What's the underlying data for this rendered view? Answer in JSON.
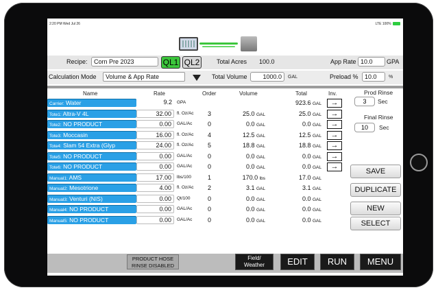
{
  "status": {
    "time": "2:20 PM  Wed Jul 26",
    "signal": "LTE",
    "battery": "100%"
  },
  "recipe": {
    "label": "Recipe:",
    "value": "Corn Pre 2023"
  },
  "quick_links": [
    "QL1",
    "QL2"
  ],
  "total_acres": {
    "label": "Total Acres",
    "value": "100.0"
  },
  "app_rate": {
    "label": "App Rate",
    "value": "10.0",
    "unit": "GPA"
  },
  "calc_mode": {
    "label": "Calculation Mode",
    "value": "Volume & App Rate"
  },
  "total_volume": {
    "label": "Total Volume",
    "value": "1000.0",
    "unit": "GAL"
  },
  "preload": {
    "label": "Preload %",
    "value": "10.0",
    "unit": "%"
  },
  "table": {
    "headers": [
      "Name",
      "Rate",
      "Order",
      "Volume",
      "Total",
      "Inv."
    ],
    "rows": [
      {
        "prefix": "Carrier:",
        "name": "Water",
        "rate": "9.2",
        "rate_unit": "GPA",
        "order": "",
        "volume": "",
        "volume_unit": "",
        "total": "923.6",
        "total_unit": "GAL",
        "inv": true,
        "rate_boxed": false
      },
      {
        "prefix": "Tote1:",
        "name": "Altra-V 4L",
        "rate": "32.00",
        "rate_unit": "fl. Oz/Ac",
        "order": "3",
        "volume": "25.0",
        "volume_unit": "GAL",
        "total": "25.0",
        "total_unit": "GAL",
        "inv": true,
        "rate_boxed": true
      },
      {
        "prefix": "Tote2:",
        "name": "NO PRODUCT",
        "rate": "0.00",
        "rate_unit": "GAL/Ac",
        "order": "0",
        "volume": "0.0",
        "volume_unit": "GAL",
        "total": "0.0",
        "total_unit": "GAL",
        "inv": true,
        "rate_boxed": true
      },
      {
        "prefix": "Tote3:",
        "name": "Moccasin",
        "rate": "16.00",
        "rate_unit": "fl. Oz/Ac",
        "order": "4",
        "volume": "12.5",
        "volume_unit": "GAL",
        "total": "12.5",
        "total_unit": "GAL",
        "inv": true,
        "rate_boxed": true
      },
      {
        "prefix": "Tote4:",
        "name": "Slam 54 Extra (Glyp",
        "rate": "24.00",
        "rate_unit": "fl. Oz/Ac",
        "order": "5",
        "volume": "18.8",
        "volume_unit": "GAL",
        "total": "18.8",
        "total_unit": "GAL",
        "inv": true,
        "rate_boxed": true
      },
      {
        "prefix": "Tote5:",
        "name": "NO PRODUCT",
        "rate": "0.00",
        "rate_unit": "GAL/Ac",
        "order": "0",
        "volume": "0.0",
        "volume_unit": "GAL",
        "total": "0.0",
        "total_unit": "GAL",
        "inv": true,
        "rate_boxed": true
      },
      {
        "prefix": "Tote6:",
        "name": "NO PRODUCT",
        "rate": "0.00",
        "rate_unit": "GAL/Ac",
        "order": "0",
        "volume": "0.0",
        "volume_unit": "GAL",
        "total": "0.0",
        "total_unit": "GAL",
        "inv": true,
        "rate_boxed": true
      },
      {
        "prefix": "Manual1:",
        "name": "AMS",
        "rate": "17.00",
        "rate_unit": "lbs/100",
        "order": "1",
        "volume": "170.0",
        "volume_unit": "lbs",
        "total": "17.0",
        "total_unit": "GAL",
        "inv": false,
        "rate_boxed": true
      },
      {
        "prefix": "Manual2:",
        "name": "Mesotrione",
        "rate": "4.00",
        "rate_unit": "fl. Oz/Ac",
        "order": "2",
        "volume": "3.1",
        "volume_unit": "GAL",
        "total": "3.1",
        "total_unit": "GAL",
        "inv": false,
        "rate_boxed": true
      },
      {
        "prefix": "Manual3:",
        "name": "Venturi (NIS)",
        "rate": "0.00",
        "rate_unit": "Qt/100",
        "order": "0",
        "volume": "0.0",
        "volume_unit": "GAL",
        "total": "0.0",
        "total_unit": "GAL",
        "inv": false,
        "rate_boxed": true
      },
      {
        "prefix": "Manual4:",
        "name": "NO PRODUCT",
        "rate": "0.00",
        "rate_unit": "GAL/Ac",
        "order": "0",
        "volume": "0.0",
        "volume_unit": "GAL",
        "total": "0.0",
        "total_unit": "GAL",
        "inv": false,
        "rate_boxed": true
      },
      {
        "prefix": "Manual5:",
        "name": "NO PRODUCT",
        "rate": "0.00",
        "rate_unit": "GAL/Ac",
        "order": "0",
        "volume": "0.0",
        "volume_unit": "GAL",
        "total": "0.0",
        "total_unit": "GAL",
        "inv": false,
        "rate_boxed": true
      }
    ]
  },
  "prod_rinse": {
    "label": "Prod Rinse",
    "value": "3",
    "unit": "Sec"
  },
  "final_rinse": {
    "label": "Final Rinse",
    "value": "10",
    "unit": "Sec"
  },
  "side_buttons": {
    "save": "SAVE",
    "duplicate": "DUPLICATE",
    "new": "NEW",
    "select": "SELECT"
  },
  "bottom": {
    "hose_line1": "PRODUCT HOSE",
    "hose_line2": "RINSE DISABLED",
    "field_line1": "Field/",
    "field_line2": "Weather",
    "edit": "EDIT",
    "run": "RUN",
    "menu": "MENU"
  },
  "colors": {
    "name_cell": "#2aa0e6",
    "ql_active": "#3cc63c",
    "ql_inactive": "#d8d8d8"
  }
}
